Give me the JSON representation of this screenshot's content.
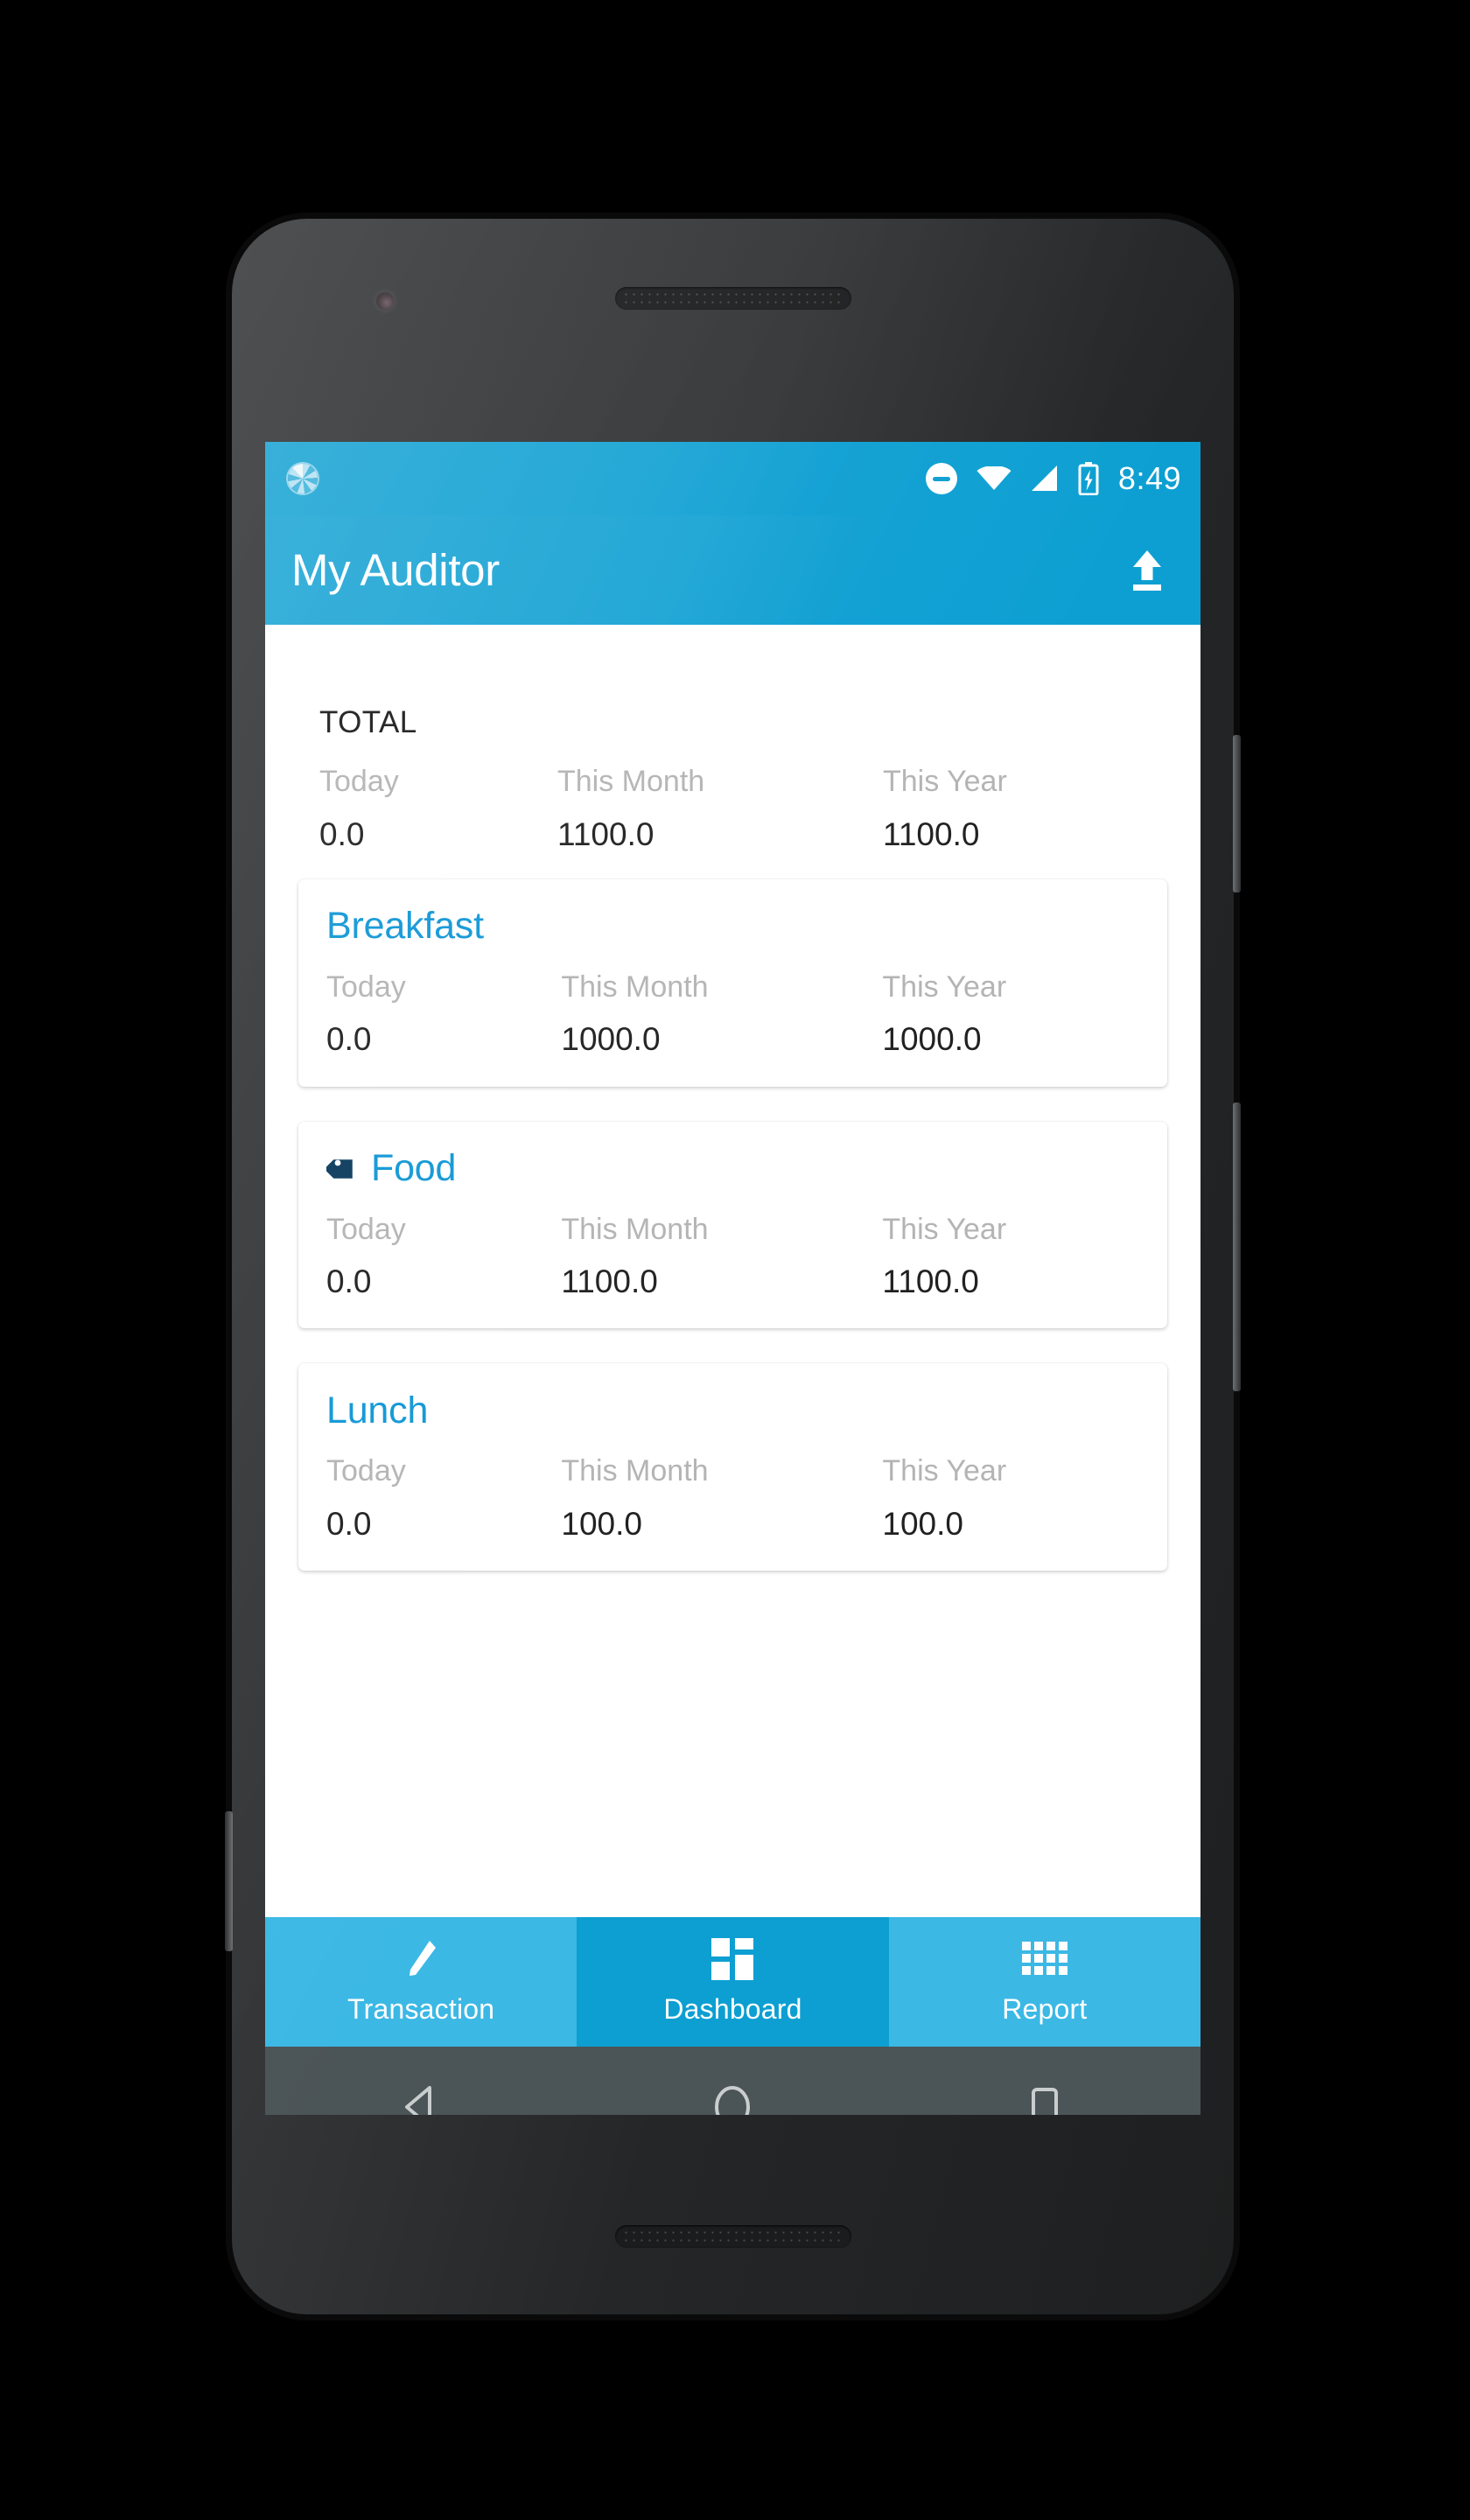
{
  "status_bar": {
    "sync_icon": "sync-spinner-icon",
    "dnd_icon": "do-not-disturb-icon",
    "wifi_icon": "wifi-icon",
    "signal_icon": "cellular-signal-icon",
    "battery_icon": "battery-charging-icon",
    "time": "8:49"
  },
  "app_bar": {
    "title": "My Auditor",
    "action_icon": "upload-icon"
  },
  "colors": {
    "primary": "#0d9fd2",
    "tab_inactive": "#3cb8e5",
    "accent_text": "#1197d6",
    "muted_text": "#b4b4b4",
    "tag_icon": "#0b3a5d",
    "navbar": "#4b5457"
  },
  "total": {
    "label": "TOTAL",
    "periods": [
      "Today",
      "This Month",
      "This Year"
    ],
    "values": [
      "0.0",
      "1100.0",
      "1100.0"
    ]
  },
  "cards": [
    {
      "title": "Breakfast",
      "has_tag_icon": false,
      "periods": [
        "Today",
        "This Month",
        "This Year"
      ],
      "values": [
        "0.0",
        "1000.0",
        "1000.0"
      ]
    },
    {
      "title": "Food",
      "has_tag_icon": true,
      "periods": [
        "Today",
        "This Month",
        "This Year"
      ],
      "values": [
        "0.0",
        "1100.0",
        "1100.0"
      ]
    },
    {
      "title": "Lunch",
      "has_tag_icon": false,
      "periods": [
        "Today",
        "This Month",
        "This Year"
      ],
      "values": [
        "0.0",
        "100.0",
        "100.0"
      ]
    }
  ],
  "bottom_nav": {
    "tabs": [
      {
        "label": "Transaction",
        "icon": "pencil-icon",
        "active": false
      },
      {
        "label": "Dashboard",
        "icon": "dashboard-grid-icon",
        "active": true
      },
      {
        "label": "Report",
        "icon": "report-grid-icon",
        "active": false
      }
    ]
  },
  "android_nav": {
    "back": "back-triangle-icon",
    "home": "home-circle-icon",
    "recents": "recents-square-icon"
  }
}
